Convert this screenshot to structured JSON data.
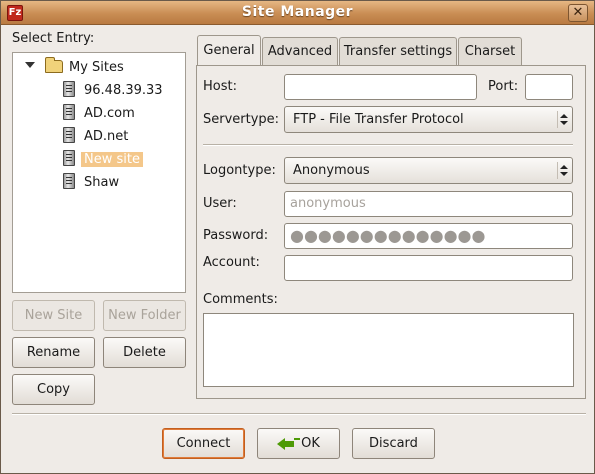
{
  "window": {
    "title": "Site Manager",
    "app_icon": "filezilla-icon",
    "close": "✕"
  },
  "tree": {
    "label": "Select Entry:",
    "root": "My Sites",
    "items": [
      {
        "label": "96.48.39.33",
        "icon": "server-icon"
      },
      {
        "label": "AD.com",
        "icon": "server-icon"
      },
      {
        "label": "AD.net",
        "icon": "server-icon"
      },
      {
        "label": "New site",
        "icon": "server-icon",
        "selected": true
      },
      {
        "label": "Shaw",
        "icon": "server-icon"
      }
    ]
  },
  "left_buttons": {
    "new_site": "New Site",
    "new_folder": "New Folder",
    "rename": "Rename",
    "delete": "Delete",
    "copy": "Copy"
  },
  "tabs": [
    "General",
    "Advanced",
    "Transfer settings",
    "Charset"
  ],
  "general": {
    "host_label": "Host:",
    "host_value": "",
    "port_label": "Port:",
    "port_value": "",
    "servertype_label": "Servertype:",
    "servertype_value": "FTP - File Transfer Protocol",
    "logontype_label": "Logontype:",
    "logontype_value": "Anonymous",
    "user_label": "User:",
    "user_value": "anonymous",
    "password_label": "Password:",
    "password_value": "●●●●●●●●●●●●●●",
    "account_label": "Account:",
    "account_value": "",
    "comments_label": "Comments:",
    "comments_value": ""
  },
  "bottom_buttons": {
    "connect": "Connect",
    "ok": "OK",
    "discard": "Discard"
  },
  "colors": {
    "titlebar": "#c98d54",
    "selection": "#f4c78a",
    "ok_arrow": "#4e9a06"
  }
}
